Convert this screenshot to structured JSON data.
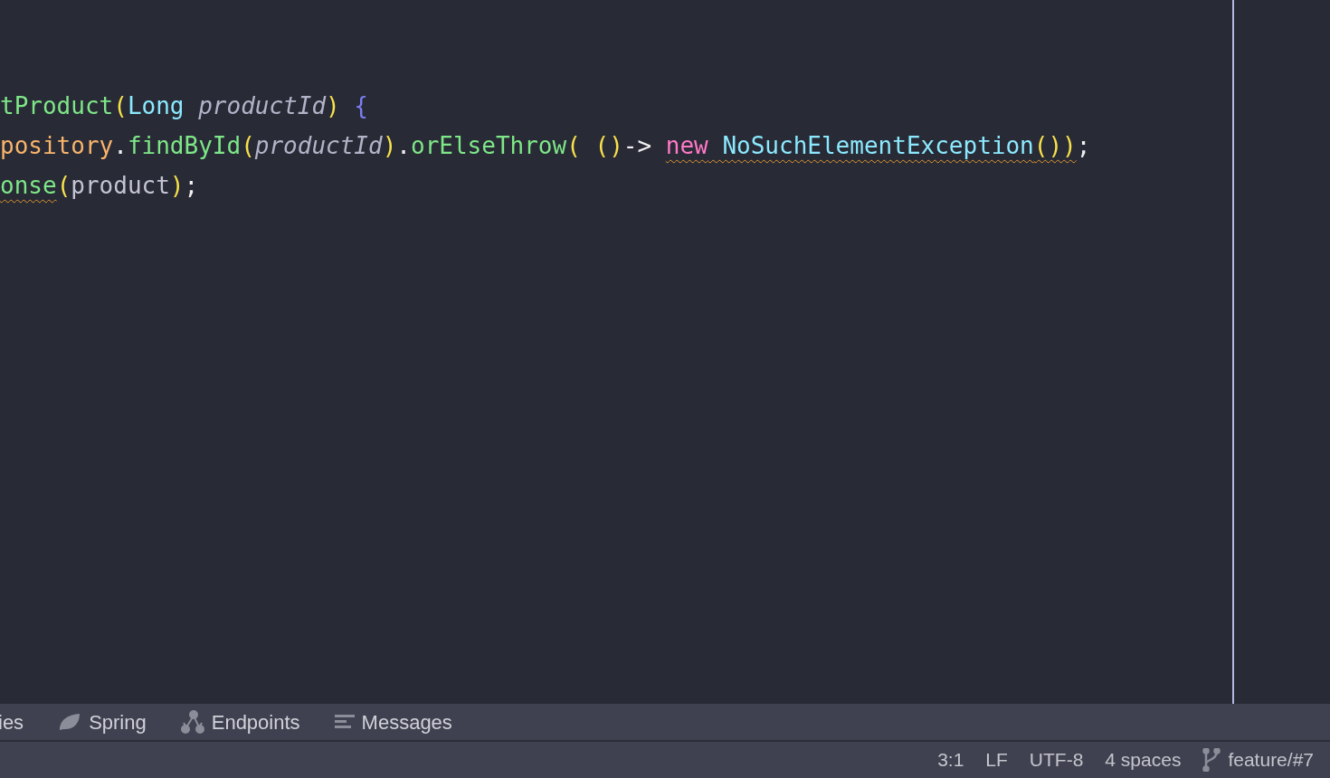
{
  "editor": {
    "lines": [
      {
        "tokens": [
          {
            "text": "tProduct",
            "kind": "method"
          },
          {
            "text": "(",
            "kind": "paren"
          },
          {
            "text": "Long",
            "kind": "type"
          },
          {
            "text": " productId",
            "kind": "param"
          },
          {
            "text": ")",
            "kind": "paren"
          },
          {
            "text": " {",
            "kind": "brace"
          }
        ]
      },
      {
        "tokens": [
          {
            "text": "pository",
            "kind": "field"
          },
          {
            "text": ".",
            "kind": "plain"
          },
          {
            "text": "findById",
            "kind": "method"
          },
          {
            "text": "(",
            "kind": "paren"
          },
          {
            "text": "productId",
            "kind": "param"
          },
          {
            "text": ")",
            "kind": "paren"
          },
          {
            "text": ".",
            "kind": "plain"
          },
          {
            "text": "orElseThrow",
            "kind": "method"
          },
          {
            "text": "(",
            "kind": "paren"
          },
          {
            "text": " ()",
            "kind": "paren"
          },
          {
            "text": "-> ",
            "kind": "plain"
          },
          {
            "text": "new",
            "kind": "keyword",
            "warning": true
          },
          {
            "text": " NoSuchElementException",
            "kind": "type",
            "warning": true
          },
          {
            "text": "())",
            "kind": "paren",
            "warning": true
          },
          {
            "text": ";",
            "kind": "plain"
          }
        ]
      },
      {
        "tokens": [
          {
            "text": "onse",
            "kind": "method",
            "warning": true
          },
          {
            "text": "(",
            "kind": "paren"
          },
          {
            "text": "product",
            "kind": "local"
          },
          {
            "text": ")",
            "kind": "paren"
          },
          {
            "text": ";",
            "kind": "plain"
          }
        ]
      }
    ]
  },
  "tool_tabs": [
    {
      "label": "ies"
    },
    {
      "label": "Spring"
    },
    {
      "label": "Endpoints"
    },
    {
      "label": "Messages"
    }
  ],
  "status_bar": [
    {
      "text": "3:1",
      "kind": "plain"
    },
    {
      "text": "LF",
      "kind": "plain"
    },
    {
      "text": "UTF-8",
      "kind": "plain"
    },
    {
      "text": "4 spaces",
      "kind": "plain"
    },
    {
      "text": "feature/#7",
      "kind": "branch"
    }
  ]
}
